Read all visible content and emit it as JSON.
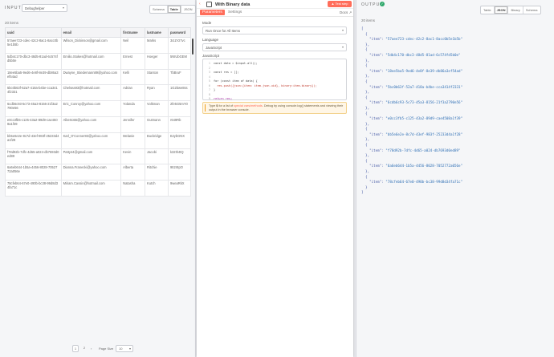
{
  "input": {
    "title": "INPUT",
    "source": "Debughelper",
    "modes": [
      "Schema",
      "Table",
      "JSON"
    ],
    "active_mode": "Table",
    "item_count": "20 items",
    "columns": [
      "uuid",
      "email",
      "firstname",
      "lastname",
      "password"
    ],
    "rows": [
      [
        "57aee723-cdec-42c2-8ac1-8acc0b5e1b5b",
        "Wilson_Dickinson@gmail.com",
        "Neil",
        "Marks",
        "3cIZ-D7vc"
      ],
      [
        "5db4c170-dbc3-48d5-81ad-6c574fd5b0e",
        "Emilio.Stokes@hotmail.com",
        "Ernest",
        "Hoeger",
        "5NIUbGEM"
      ],
      [
        "18ee5ba5-9ed6-4e8f-8e39-db86a3ef54ad",
        "Dwayne_Stiedemann89@yahoo.com",
        "Kelli",
        "Stanton",
        "TbBruF"
      ],
      [
        "5bc0b63f-52a7-418a-b4be-cca3414f2331",
        "Chelsea93@hotmail.com",
        "Adrian",
        "Ryan",
        "1G2bwe8ss"
      ],
      [
        "6cdb6c93-5c73-45a3-8156-21f3a2790e56",
        "Eric_Conroy@yahoo.com",
        "Yolanda",
        "Volkman",
        "2fe5G5mY0"
      ],
      [
        "e0cc3fb5-c125-43a2-89d9-cae4508a1f39",
        "Alberto55@yahoo.com",
        "Jennifer",
        "Gutmann",
        "r649Rb"
      ],
      [
        "bb5e6e2e-8c7d-43ef-983f-25233d4a1f28",
        "Karl_O'Conner83@yahoo.com",
        "Melanie",
        "Buckridge",
        "BJybGNX"
      ],
      [
        "f78d92b-7dfc-4d65-a024-db7693d0ed89",
        "Patty44@gmail.com",
        "Kevin",
        "Jacobi",
        "k32th4tQ"
      ],
      [
        "6a6eb644-1b5a-4456-8028-7052772a056e",
        "Dianna.Franecki@yahoo.com",
        "Alberta",
        "Ritchie",
        "9tI2r8pO"
      ],
      [
        "78cfeb64-67e0-490b-bc38-99d8d34fa71c",
        "Miriam.Cassin@hotmail.com",
        "Natasha",
        "Kutch",
        "9weaRkX"
      ]
    ],
    "pager": {
      "pages": [
        "1",
        "2"
      ],
      "current": "1",
      "next": "›",
      "page_size_label": "Page Size",
      "page_size": "10"
    }
  },
  "node": {
    "back": "‹",
    "title": "With Binary data",
    "test_label": "▲ Test step",
    "tabs": [
      "Parameters",
      "Settings"
    ],
    "active_tab": "Parameters",
    "docs": "Docs ↗",
    "mode_label": "Mode",
    "mode_value": "Run Once for All Items",
    "language_label": "Language",
    "language_value": "JavaScript",
    "code_label": "JavaScript",
    "code_lines": [
      "const data = $input.all();",
      "",
      "const res = [];",
      "",
      "for (const item of data) {",
      "  res.push({json:{item: item.json.uid}, binary:item.binary});",
      "}",
      "",
      "return res;"
    ],
    "hint_prefix": "Type ",
    "hint_var": "$",
    "hint_mid": " for a list of ",
    "hint_link": "special vars/methods",
    "hint_suffix": ". Debug by using console.log() statements and viewing their output in the browser console."
  },
  "output": {
    "title": "OUTPUT",
    "item_count": "20 items",
    "modes": [
      "Table",
      "JSON",
      "Binary",
      "Schema"
    ],
    "active_mode": "JSON",
    "items": [
      "57aee723-cdec-42c2-8ac1-8acc0b5e1b5b",
      "5db4c170-dbc3-48d5-81ad-6c574fd5b0e",
      "18ee5ba5-9ed6-4e8f-8e39-db86a3ef54ad",
      "5bc0b63f-52a7-418a-b4be-cca3414f2331",
      "6cdb6c93-5c73-45a3-8156-21f3a2790e56",
      "e0cc3fb5-c125-43a2-89d9-cae4508a1f39",
      "bb5e6e2e-8c7d-43ef-983f-25233d4a1f28",
      "f78d92b-7dfc-4d65-a024-db7693d0ed89",
      "6a6eb644-1b5a-4456-8028-7052772a056e",
      "78cfeb64-67e0-490b-bc38-99d8d34fa71c"
    ]
  }
}
